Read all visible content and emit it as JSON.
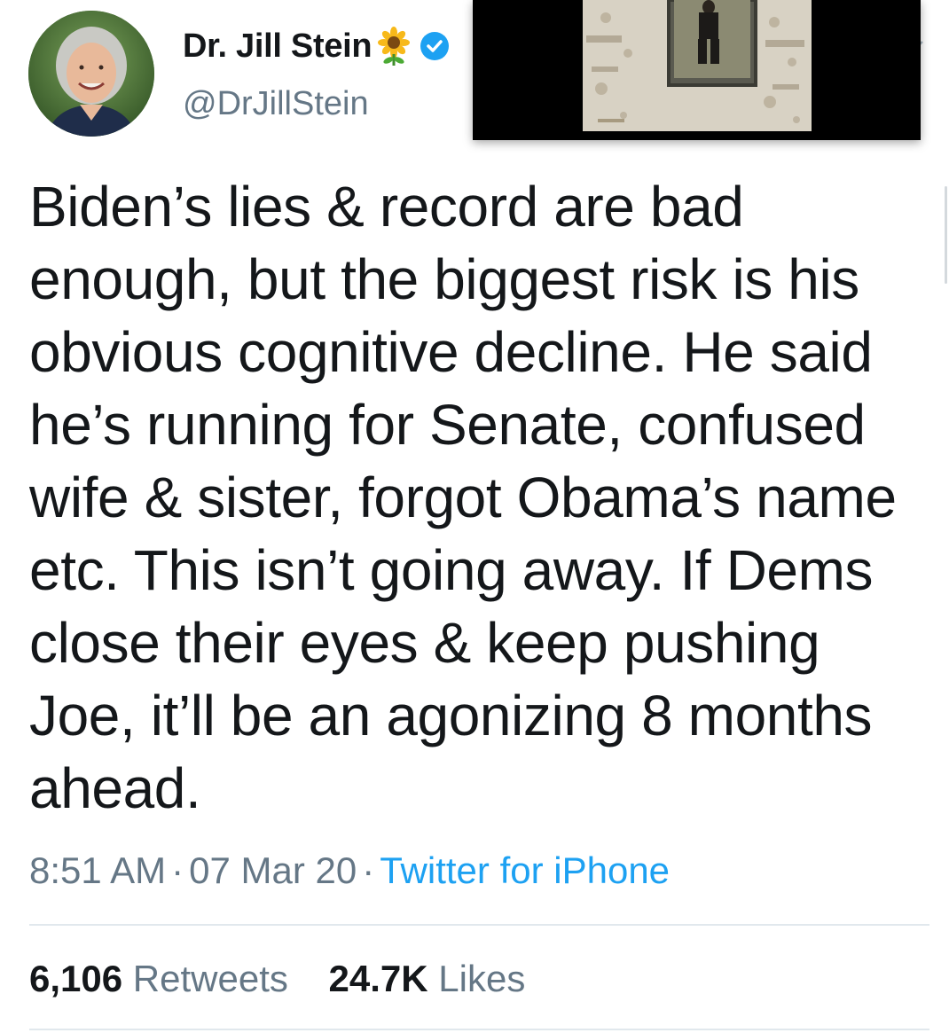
{
  "author": {
    "display_name": "Dr. Jill Stein",
    "handle": "@DrJillStein",
    "name_emoji": "sunflower-icon",
    "verified": true
  },
  "tweet": {
    "text": "Biden’s lies & record are bad\nenough, but the biggest risk is his\nobvious cognitive decline. He said\nhe’s running for Senate, confused\nwife & sister, forgot Obama’s name\netc. This isn’t going away. If Dems\nclose their eyes & keep pushing\nJoe, it’ll be an agonizing 8 months\nahead.",
    "time": "8:51 AM",
    "date": "07 Mar 20",
    "separator": "·",
    "source": "Twitter for iPhone"
  },
  "stats": {
    "retweets_count": "6,106",
    "retweets_label": "Retweets",
    "likes_count": "24.7K",
    "likes_label": "Likes"
  },
  "colors": {
    "text": "#14171a",
    "secondary": "#657786",
    "link": "#1da1f2",
    "divider": "#e1e8ed"
  }
}
